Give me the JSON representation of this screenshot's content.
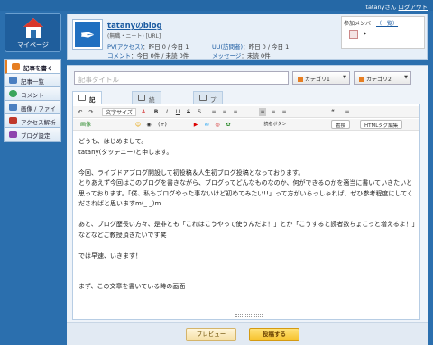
{
  "topbar": {
    "user_text": "tatanyさん",
    "logout": "ログアウト"
  },
  "mypage": {
    "label": "マイページ"
  },
  "nav": [
    {
      "label": "記事を書く",
      "icon": "pencil-icon",
      "color": "#e67e22"
    },
    {
      "label": "記事一覧",
      "icon": "list-icon",
      "color": "#4a7fc1"
    },
    {
      "label": "コメント",
      "icon": "comment-icon",
      "color": "#3aa55c"
    },
    {
      "label": "画像 / ファイル",
      "icon": "image-icon",
      "color": "#4a7fc1"
    },
    {
      "label": "アクセス解析",
      "icon": "chart-icon",
      "color": "#c0392b"
    },
    {
      "label": "ブログ設定",
      "icon": "wrench-icon",
      "color": "#8e44ad"
    }
  ],
  "blog": {
    "name": "tatanyのblog",
    "sub": "(無職・ニート) [URL]",
    "pv_label": "PV(アクセス)",
    "pv_value": "：昨日 0 / 今日 1",
    "uu_label": "UU(訪問者)",
    "uu_value": "：昨日 0 / 今日 1",
    "comment_label": "コメント",
    "comment_value": "：今日 0件 / 未読 0件",
    "message_label": "メッセージ",
    "message_value": "：未読 0件"
  },
  "members": {
    "label": "参加メンバー",
    "list_link": "（一覧）"
  },
  "editor": {
    "title_placeholder": "記事タイトル",
    "category1": "カテゴリ1",
    "category2": "カテゴリ2",
    "tabs": [
      "記事を書く",
      "続きを書く",
      "プライベート"
    ],
    "toolbar1": [
      "↶",
      "↷",
      "文字サイズ",
      "A",
      "B",
      "I",
      "U",
      "S",
      "S",
      "≡",
      "≡",
      "≡",
      "≡",
      "≡",
      "≡",
      "“",
      "≡"
    ],
    "toolbar2": [
      "画像",
      "☺",
      "◉",
      "(+)",
      "▶",
      "✉",
      "◎",
      "✿",
      "読者ボタン"
    ],
    "replace_btn": "置換",
    "html_btn": "HTMLタグ編集",
    "body": [
      "どうも、はじめまして。",
      "tatany(タッテニー)と申します。",
      "",
      "今回、ライブドアブログ開設して初投稿＆人生初ブログ投稿となっております。",
      "とりあえず今回はこのブログを書きながら、ブログってどんなものなのか、何ができるのかを適当に書いていきたいと思っております。「僕、私もブログやった事ないけど初めてみたい!!」って方がいらっしゃれば、ぜひ参考程度にしてくださればと思いますm(_ _)m",
      "",
      "あと、ブログ歴長い方々、是非とも「これはこうやって使うんだよ！」とか「こうすると読者数ちょこっと増えるよ！」などなどご教授頂きたいです笑",
      "",
      "では早速、いきます！",
      "",
      "",
      "まず、この文章を書いている時の画面"
    ],
    "preview_btn": "プレビュー",
    "post_btn": "投稿する"
  }
}
